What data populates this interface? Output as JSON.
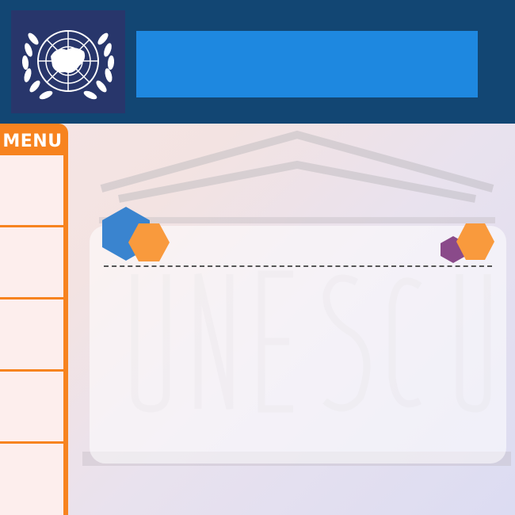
{
  "header": {
    "logo": {
      "icon": "un-emblem-icon",
      "color": "#ffffff"
    },
    "title": ""
  },
  "sidebar": {
    "menu_label": "MENU",
    "items": [
      {
        "label": ""
      },
      {
        "label": ""
      },
      {
        "label": ""
      },
      {
        "label": ""
      },
      {
        "label": ""
      }
    ]
  },
  "watermark": {
    "text": "UNESCO",
    "icon": "unesco-temple-icon"
  },
  "content_card": {
    "decorations": [
      "blue-hexagon-icon",
      "orange-hexagon-icon",
      "purple-hexagon-icon",
      "orange-hexagon-icon"
    ]
  },
  "colors": {
    "header_bg": "#124673",
    "logo_bg": "#28366b",
    "title_bar": "#1e88e0",
    "menu_orange": "#f7831f",
    "menu_item_bg": "#fdeeed",
    "hex_blue": "#3a84cf",
    "hex_orange": "#f99a3d",
    "hex_purple": "#8a4a8a"
  }
}
